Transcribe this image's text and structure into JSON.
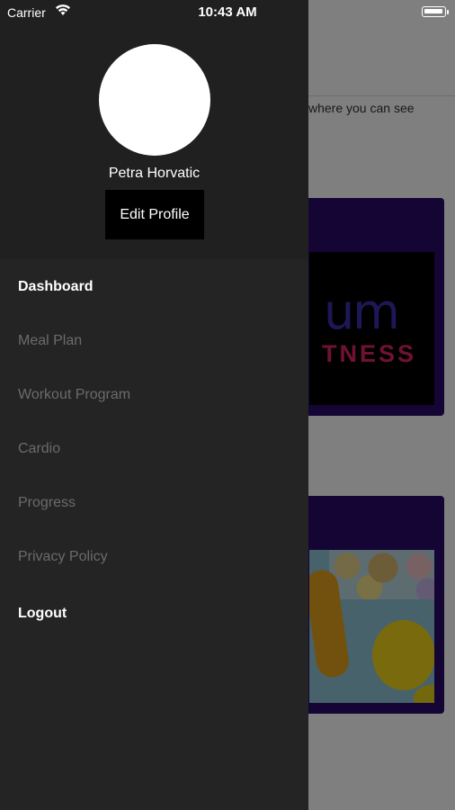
{
  "status_bar": {
    "carrier": "Carrier",
    "time": "10:43 AM",
    "wifi_icon": "wifi-icon",
    "battery_icon": "battery-icon"
  },
  "background": {
    "snippet_text": "where you can see",
    "logo_text": "TNESS"
  },
  "drawer": {
    "user_name": "Petra Horvatic",
    "edit_profile_label": "Edit Profile",
    "nav_items": [
      {
        "label": "Dashboard",
        "active": true
      },
      {
        "label": "Meal Plan",
        "active": false
      },
      {
        "label": "Workout Program",
        "active": false
      },
      {
        "label": "Cardio",
        "active": false
      },
      {
        "label": "Progress",
        "active": false
      },
      {
        "label": "Privacy Policy",
        "active": false
      }
    ],
    "logout_label": "Logout"
  },
  "colors": {
    "drawer_bg": "#242424",
    "active_text": "#ffffff",
    "inactive_text": "#6b6b6b",
    "card_bg": "#2b0a6b"
  }
}
